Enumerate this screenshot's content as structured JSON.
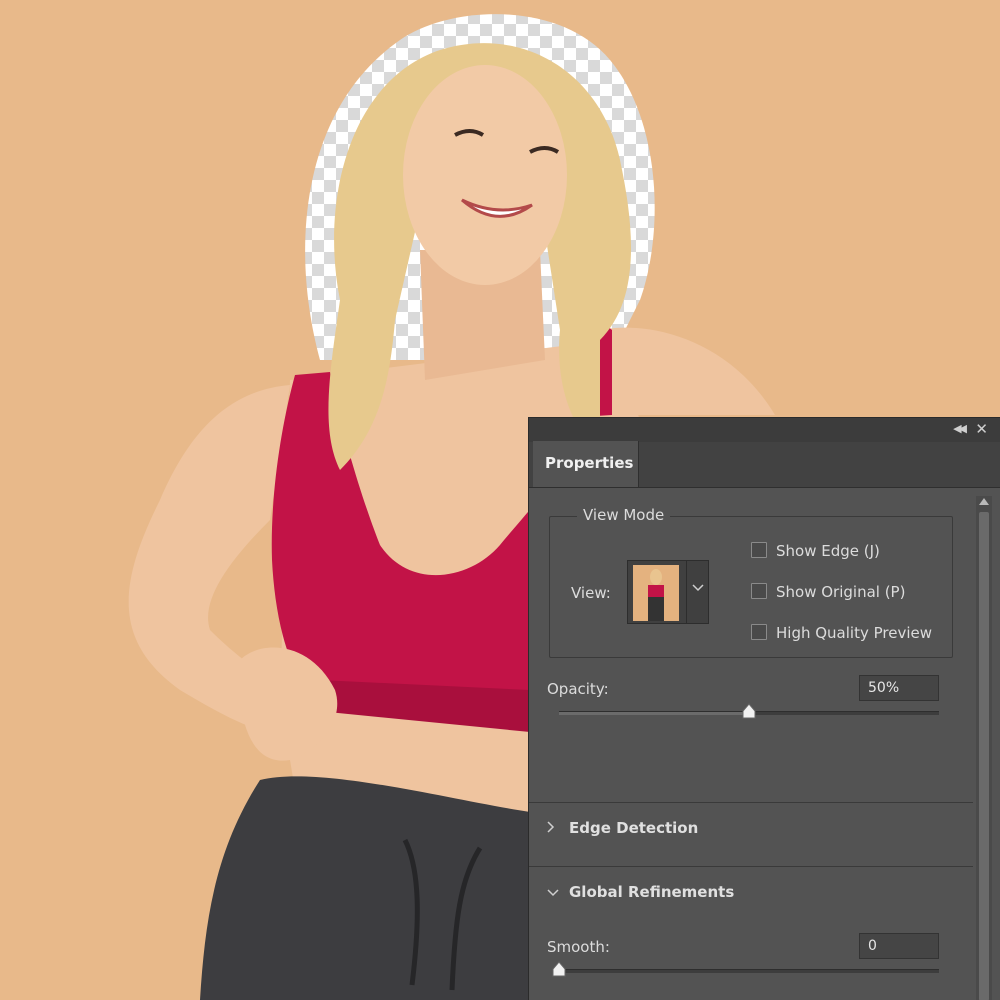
{
  "colors": {
    "background": "#e8b98a",
    "panel": "#535353",
    "top": "#c21347",
    "pants": "#3d3d40",
    "hair": "#e7c98d",
    "skin": "#efc49f"
  },
  "icons": {
    "collapse": "double-chevron-left-icon",
    "close": "close-icon",
    "section_collapsed": "chevron-right-icon",
    "section_expanded": "chevron-down-icon",
    "view_dropdown": "chevron-down-icon"
  },
  "panel": {
    "tab_label": "Properties",
    "view_mode": {
      "title": "View Mode",
      "view_label": "View:",
      "checkboxes": [
        {
          "label": "Show Edge (J)",
          "checked": false
        },
        {
          "label": "Show Original (P)",
          "checked": false
        },
        {
          "label": "High Quality Preview",
          "checked": false
        }
      ]
    },
    "opacity": {
      "label": "Opacity:",
      "value": "50%",
      "fraction": 0.5
    },
    "edge_detection": {
      "label": "Edge Detection",
      "expanded": false
    },
    "global_refinements": {
      "label": "Global Refinements",
      "expanded": true
    },
    "smooth": {
      "label": "Smooth:",
      "value": "0",
      "fraction": 0
    }
  }
}
